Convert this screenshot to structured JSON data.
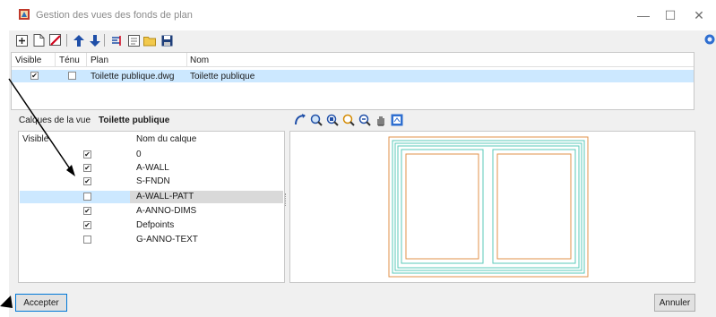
{
  "window": {
    "title": "Gestion des vues des fonds de plan",
    "minimize_glyph": "—",
    "maximize_glyph": "☐",
    "close_glyph": "✕"
  },
  "toolbar": {
    "icons": [
      "new-view-icon",
      "blank-page-icon",
      "delete-icon",
      "move-up-icon",
      "move-down-icon",
      "rename-icon",
      "properties-icon",
      "open-folder-icon",
      "save-icon"
    ]
  },
  "views_table": {
    "columns": [
      "Visible",
      "Ténu",
      "Plan",
      "Nom"
    ],
    "rows": [
      {
        "visible": true,
        "tenu": false,
        "plan": "Toilette publique.dwg",
        "nom": "Toilette publique"
      }
    ]
  },
  "layers": {
    "section_label": "Calques de la vue",
    "view_name": "Toilette publique",
    "columns": [
      "Visible",
      "Nom du calque"
    ],
    "rows": [
      {
        "visible": true,
        "name": "0"
      },
      {
        "visible": true,
        "name": "A-WALL"
      },
      {
        "visible": true,
        "name": "S-FNDN"
      },
      {
        "visible": false,
        "name": "A-WALL-PATT",
        "selected": true
      },
      {
        "visible": true,
        "name": "A-ANNO-DIMS"
      },
      {
        "visible": true,
        "name": "Defpoints"
      },
      {
        "visible": false,
        "name": "G-ANNO-TEXT"
      }
    ]
  },
  "preview_tools": [
    "pan-icon",
    "zoom-extents-icon",
    "zoom-window-icon",
    "zoom-previous-icon",
    "zoom-out-icon",
    "hand-icon",
    "layer-refresh-icon"
  ],
  "buttons": {
    "accept": "Accepter",
    "cancel": "Annuler"
  },
  "colors": {
    "selection": "#cce8ff",
    "accent": "#0078d7",
    "plan_orange": "#e0914a",
    "plan_cyan": "#5ac8b8"
  }
}
